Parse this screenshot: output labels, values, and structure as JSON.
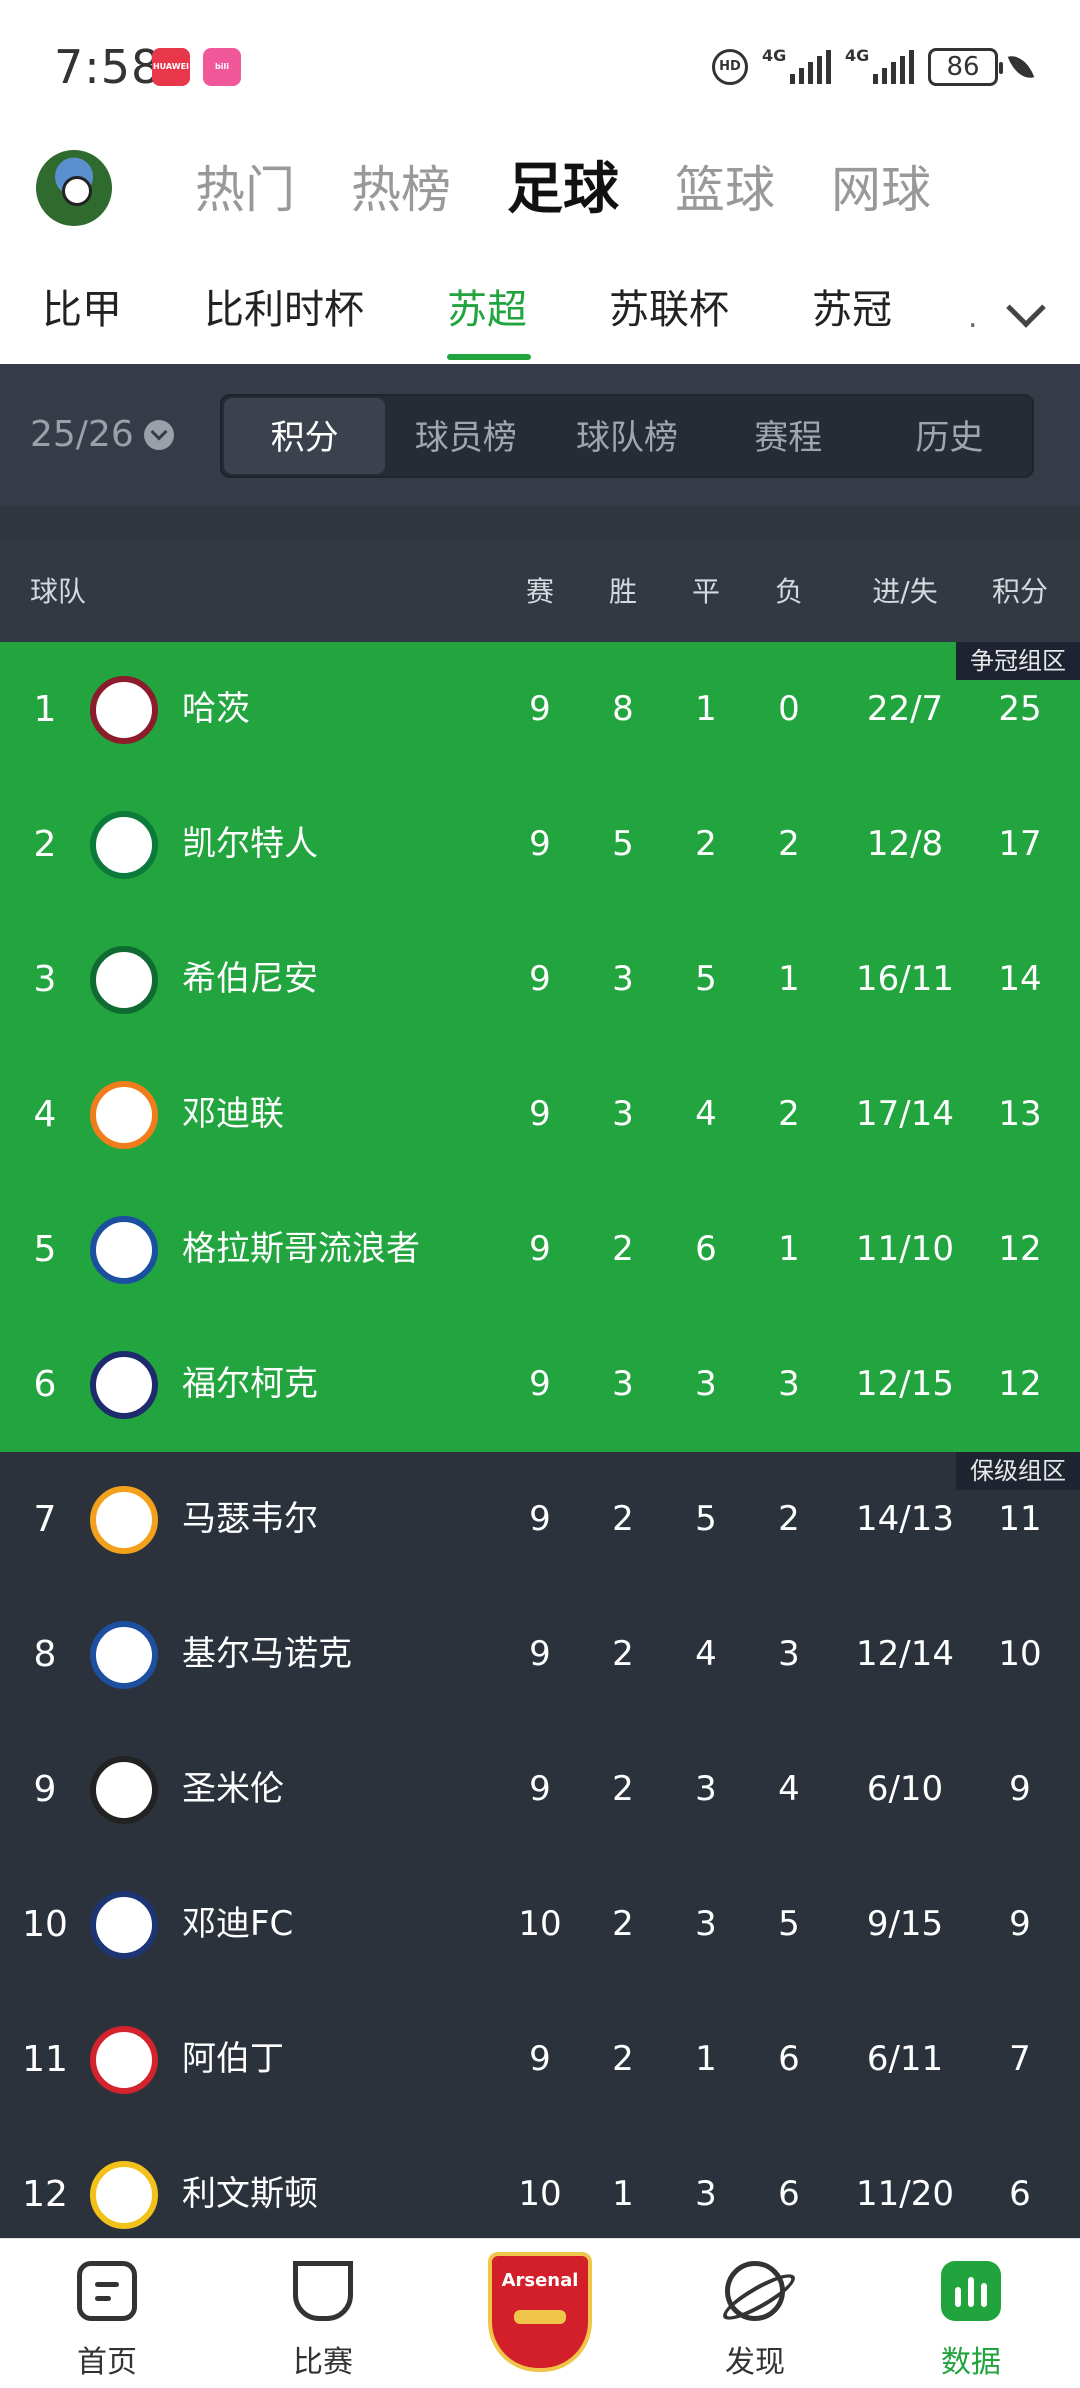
{
  "status_bar": {
    "time": "7:58",
    "signal1_label": "4G",
    "signal2_label": "4G",
    "hd_label": "HD",
    "battery": "86"
  },
  "top_tabs": [
    {
      "label": "热门",
      "active": false
    },
    {
      "label": "热榜",
      "active": false
    },
    {
      "label": "足球",
      "active": true
    },
    {
      "label": "篮球",
      "active": false
    },
    {
      "label": "网球",
      "active": false
    }
  ],
  "league_tabs": [
    {
      "label": "比甲",
      "active": false
    },
    {
      "label": "比利时杯",
      "active": false
    },
    {
      "label": "苏超",
      "active": true
    },
    {
      "label": "苏联杯",
      "active": false
    },
    {
      "label": "苏冠",
      "active": false
    }
  ],
  "season": "25/26",
  "segments": [
    {
      "label": "积分",
      "active": true
    },
    {
      "label": "球员榜",
      "active": false
    },
    {
      "label": "球队榜",
      "active": false
    },
    {
      "label": "赛程",
      "active": false
    },
    {
      "label": "历史",
      "active": false
    }
  ],
  "table": {
    "headers": {
      "team": "球队",
      "played": "赛",
      "won": "胜",
      "drawn": "平",
      "lost": "负",
      "goals": "进/失",
      "points": "积分"
    },
    "zones": {
      "championship": "争冠组区",
      "relegation": "保级组区"
    },
    "rows": [
      {
        "rank": "1",
        "team": "哈茨",
        "p": "9",
        "w": "8",
        "d": "1",
        "l": "0",
        "gd": "22/7",
        "pts": "25",
        "logo_color": "#8a1c2b",
        "zone": "green"
      },
      {
        "rank": "2",
        "team": "凯尔特人",
        "p": "9",
        "w": "5",
        "d": "2",
        "l": "2",
        "gd": "12/8",
        "pts": "17",
        "logo_color": "#0c7a3b",
        "zone": "green"
      },
      {
        "rank": "3",
        "team": "希伯尼安",
        "p": "9",
        "w": "3",
        "d": "5",
        "l": "1",
        "gd": "16/11",
        "pts": "14",
        "logo_color": "#0f6b32",
        "zone": "green"
      },
      {
        "rank": "4",
        "team": "邓迪联",
        "p": "9",
        "w": "3",
        "d": "4",
        "l": "2",
        "gd": "17/14",
        "pts": "13",
        "logo_color": "#f07c1b",
        "zone": "green"
      },
      {
        "rank": "5",
        "team": "格拉斯哥流浪者",
        "p": "9",
        "w": "2",
        "d": "6",
        "l": "1",
        "gd": "11/10",
        "pts": "12",
        "logo_color": "#1b4fa0",
        "zone": "green"
      },
      {
        "rank": "6",
        "team": "福尔柯克",
        "p": "9",
        "w": "3",
        "d": "3",
        "l": "3",
        "gd": "12/15",
        "pts": "12",
        "logo_color": "#1d2a6b",
        "zone": "green"
      },
      {
        "rank": "7",
        "team": "马瑟韦尔",
        "p": "9",
        "w": "2",
        "d": "5",
        "l": "2",
        "gd": "14/13",
        "pts": "11",
        "logo_color": "#f3a01d",
        "zone": "dark"
      },
      {
        "rank": "8",
        "team": "基尔马诺克",
        "p": "9",
        "w": "2",
        "d": "4",
        "l": "3",
        "gd": "12/14",
        "pts": "10",
        "logo_color": "#1d4f9e",
        "zone": "dark"
      },
      {
        "rank": "9",
        "team": "圣米伦",
        "p": "9",
        "w": "2",
        "d": "3",
        "l": "4",
        "gd": "6/10",
        "pts": "9",
        "logo_color": "#222222",
        "zone": "dark"
      },
      {
        "rank": "10",
        "team": "邓迪FC",
        "p": "10",
        "w": "2",
        "d": "3",
        "l": "5",
        "gd": "9/15",
        "pts": "9",
        "logo_color": "#1d3572",
        "zone": "dark"
      },
      {
        "rank": "11",
        "team": "阿伯丁",
        "p": "9",
        "w": "2",
        "d": "1",
        "l": "6",
        "gd": "6/11",
        "pts": "7",
        "logo_color": "#d3232c",
        "zone": "dark"
      },
      {
        "rank": "12",
        "team": "利文斯顿",
        "p": "10",
        "w": "1",
        "d": "3",
        "l": "6",
        "gd": "11/20",
        "pts": "6",
        "logo_color": "#f2c21a",
        "zone": "dark"
      }
    ]
  },
  "bottom_nav": [
    {
      "label": "首页",
      "icon": "home-icon",
      "active": false
    },
    {
      "label": "比赛",
      "icon": "trophy-icon",
      "active": false
    },
    {
      "label": "发现",
      "icon": "planet-icon",
      "active": false
    },
    {
      "label": "数据",
      "icon": "data-icon",
      "active": true
    }
  ],
  "crest_text": "Arsenal",
  "colors": {
    "accent": "#21a33d",
    "panel": "#2b323c",
    "zone_green": "#22a43f"
  }
}
